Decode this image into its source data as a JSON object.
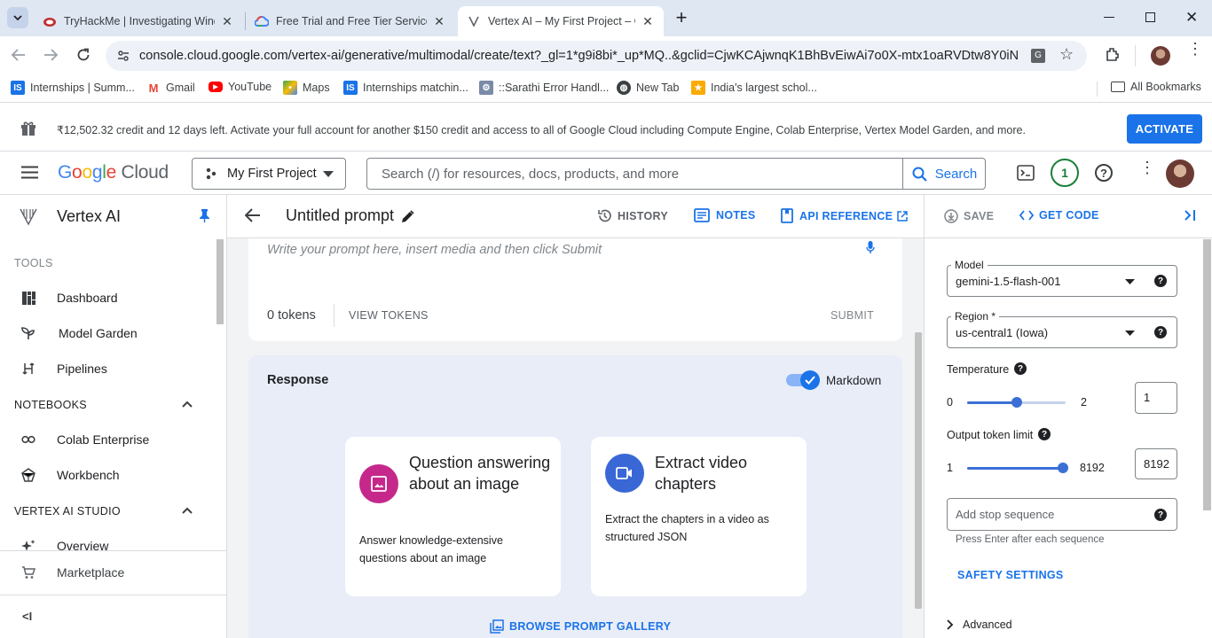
{
  "browser": {
    "tabs": [
      {
        "title": "TryHackMe | Investigating Wind",
        "active": false
      },
      {
        "title": "Free Trial and Free Tier Services",
        "active": false
      },
      {
        "title": "Vertex AI – My First Project – Go",
        "active": true
      }
    ],
    "new_tab": "+",
    "url": "console.cloud.google.com/vertex-ai/generative/multimodal/create/text?_gl=1*g9i8bi*_up*MQ..&gclid=CjwKCAjwnqK1BhBvEiwAi7o0X-mtx1oaRVDtw8Y0iNCfy0...",
    "bookmarks": [
      {
        "label": "Internships | Summ...",
        "icon": "is-icon"
      },
      {
        "label": "Gmail",
        "icon": "gmail-icon"
      },
      {
        "label": "YouTube",
        "icon": "youtube-icon"
      },
      {
        "label": "Maps",
        "icon": "maps-icon"
      },
      {
        "label": "Internships matchin...",
        "icon": "is-icon"
      },
      {
        "label": "::Sarathi Error Handl...",
        "icon": "sarathi-icon"
      },
      {
        "label": "New Tab",
        "icon": "globe-icon"
      },
      {
        "label": "India's largest schol...",
        "icon": "scholarship-icon"
      }
    ],
    "all_bookmarks": "All Bookmarks"
  },
  "banner": {
    "text": "₹12,502.32 credit and 12 days left. Activate your full account for another $150 credit and access to all of Google Cloud including Compute Engine, Colab Enterprise, Vertex Model Garden, and more.",
    "activate": "ACTIVATE"
  },
  "header": {
    "logo": "Google Cloud",
    "project": "My First Project",
    "search_placeholder": "Search (/) for resources, docs, products, and more",
    "search_button": "Search",
    "notifications": "1"
  },
  "sidebar": {
    "title": "Vertex AI",
    "tools_label": "TOOLS",
    "tools": [
      "Dashboard",
      "Model Garden",
      "Pipelines"
    ],
    "notebooks_label": "NOTEBOOKS",
    "notebooks": [
      "Colab Enterprise",
      "Workbench"
    ],
    "studio_label": "VERTEX AI STUDIO",
    "studio": [
      "Overview"
    ],
    "marketplace": "Marketplace",
    "collapse": "<I"
  },
  "main": {
    "title": "Untitled prompt",
    "history": "HISTORY",
    "notes": "NOTES",
    "api_reference": "API REFERENCE",
    "prompt_placeholder": "Write your prompt here, insert media and then click Submit",
    "tokens_count": "0",
    "tokens_label": "tokens",
    "view_tokens": "VIEW TOKENS",
    "submit": "SUBMIT",
    "response_title": "Response",
    "markdown_label": "Markdown",
    "markdown_enabled": true,
    "cards": [
      {
        "title": "Question answering about an image",
        "desc": "Answer knowledge-extensive questions about an image",
        "icon": "image-icon",
        "color": "#c5288a"
      },
      {
        "title": "Extract video chapters",
        "desc": "Extract the chapters in a video as structured JSON",
        "icon": "video-icon",
        "color": "#3967d6"
      }
    ],
    "browse_gallery": "BROWSE PROMPT GALLERY"
  },
  "panel": {
    "save": "SAVE",
    "get_code": "GET CODE",
    "model_label": "Model",
    "model_value": "gemini-1.5-flash-001",
    "region_label": "Region *",
    "region_value": "us-central1 (Iowa)",
    "temperature_label": "Temperature",
    "temperature_min": "0",
    "temperature_max": "2",
    "temperature_value": "1",
    "temperature_fraction": 0.5,
    "output_label": "Output token limit",
    "output_min": "1",
    "output_max": "8192",
    "output_value": "8192",
    "output_fraction": 1.0,
    "stop_placeholder": "Add stop sequence",
    "stop_hint": "Press Enter after each sequence",
    "safety": "SAFETY SETTINGS",
    "advanced": "Advanced"
  }
}
